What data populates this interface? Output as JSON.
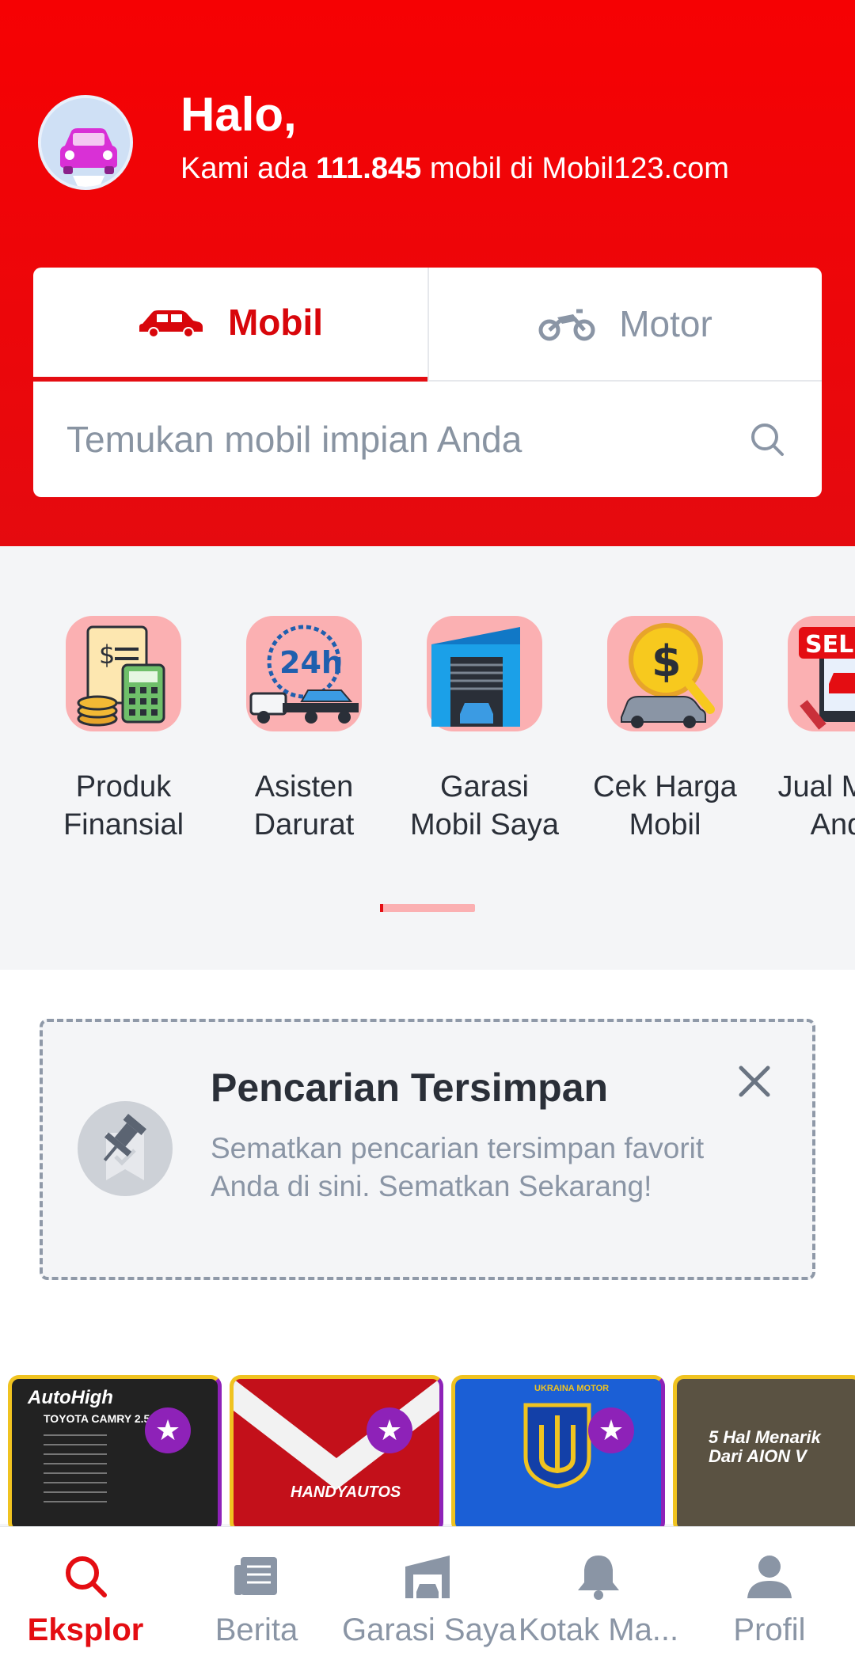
{
  "header": {
    "greeting": "Halo,",
    "sub_prefix": "Kami ada ",
    "car_count": "111.845",
    "sub_suffix": " mobil di Mobil123.com",
    "tabs": [
      {
        "label": "Mobil",
        "icon": "car-icon",
        "active": true
      },
      {
        "label": "Motor",
        "icon": "motorcycle-icon",
        "active": false
      }
    ],
    "search_placeholder": "Temukan mobil impian Anda"
  },
  "categories": [
    {
      "label": "Produk\nFinansial",
      "icon": "calculator-icon"
    },
    {
      "label": "Asisten\nDarurat",
      "icon": "tow-truck-24h-icon"
    },
    {
      "label": "Garasi\nMobil Saya",
      "icon": "garage-icon"
    },
    {
      "label": "Cek Harga\nMobil",
      "icon": "price-check-icon"
    },
    {
      "label": "Jual Mobil\nAnda",
      "icon": "sell-car-icon"
    }
  ],
  "saved_search": {
    "title": "Pencarian Tersimpan",
    "description": "Sematkan pencarian tersimpan favorit Anda di sini. Sematkan Sekarang!"
  },
  "stories": [
    {
      "label": "AutoHigh",
      "caption": "TOYOTA CAMRY 2.5"
    },
    {
      "label": "HANDYAUTOS",
      "caption": ""
    },
    {
      "label": "UKRAINA MOTOR",
      "caption": ""
    },
    {
      "label": "",
      "caption": "5 Hal Menarik Dari AION V"
    }
  ],
  "bottom_nav": [
    {
      "label": "Eksplor",
      "icon": "search-icon",
      "active": true
    },
    {
      "label": "Berita",
      "icon": "news-icon",
      "active": false
    },
    {
      "label": "Garasi Saya",
      "icon": "garage-icon",
      "active": false
    },
    {
      "label": "Kotak Ma...",
      "icon": "bell-icon",
      "active": false
    },
    {
      "label": "Profil",
      "icon": "profile-icon",
      "active": false
    }
  ],
  "colors": {
    "brand_red": "#e40d12",
    "muted": "#8a95a5",
    "story_star": "#8e22b8"
  }
}
